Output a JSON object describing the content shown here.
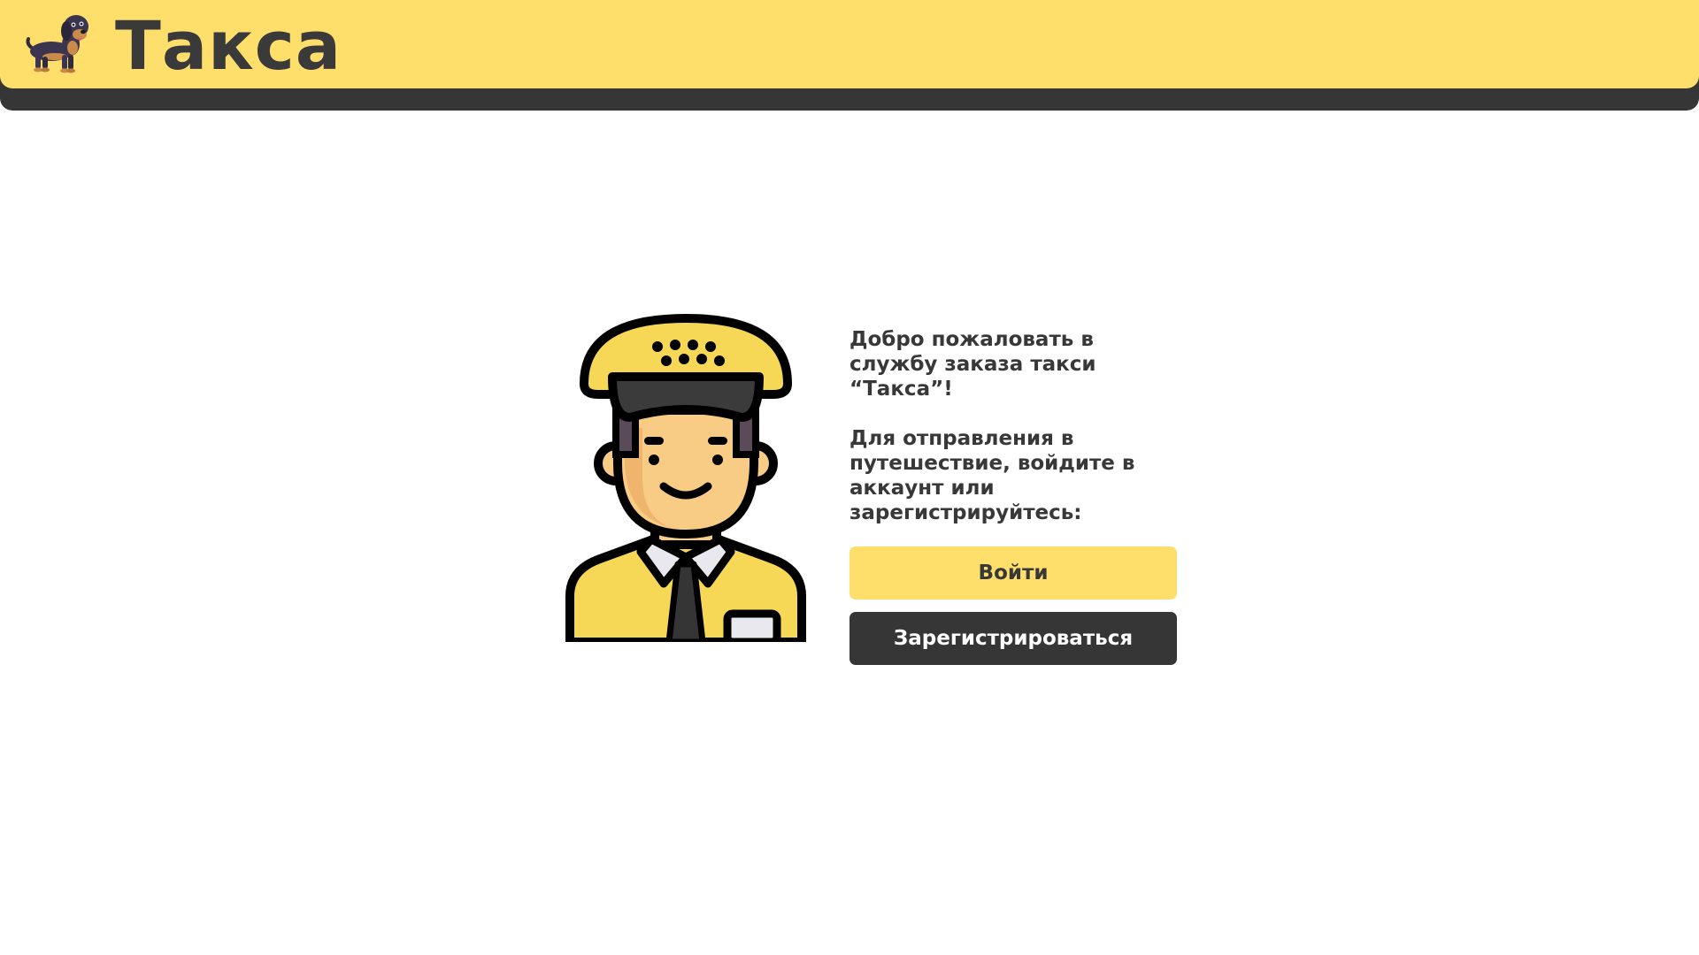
{
  "header": {
    "brand": "Такса",
    "logo_icon": "dachshund-icon",
    "bg_color": "#ffdf6b",
    "shadow_color": "#363636"
  },
  "main": {
    "illustration_icon": "taxi-driver-icon",
    "welcome_text": "Добро пожаловать в службу заказа такси “Такса”!",
    "instruction_text": "Для отправления в путешествие, войдите в аккаунт или зарегистрируйтесь:",
    "login_button": "Войти",
    "register_button": "Зарегистрироваться",
    "login_color": "#ffdf6b",
    "register_color": "#363636"
  }
}
